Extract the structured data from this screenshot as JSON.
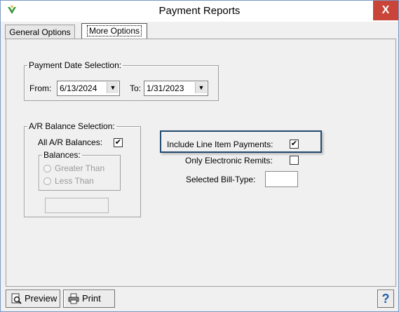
{
  "window": {
    "title": "Payment Reports",
    "close_label": "X"
  },
  "tabs": [
    {
      "label": "General Options",
      "selected": false
    },
    {
      "label": "More Options",
      "selected": true
    }
  ],
  "payment_date": {
    "legend": "Payment Date Selection:",
    "from_label": "From:",
    "from_value": "6/13/2024",
    "to_label": "To:",
    "to_value": "1/31/2023"
  },
  "ar_balance": {
    "legend": "A/R Balance Selection:",
    "all_label": "All A/R Balances:",
    "all_checked": true,
    "balances_legend": "Balances:",
    "greater_label": "Greater Than",
    "less_label": "Less Than",
    "amount_value": ""
  },
  "options": {
    "line_item_label": "Include Line Item Payments:",
    "line_item_checked": true,
    "electronic_label": "Only Electronic Remits:",
    "electronic_checked": false,
    "bill_type_label": "Selected Bill-Type:",
    "bill_type_value": ""
  },
  "buttons": {
    "preview_label": "Preview",
    "print_label": "Print",
    "help_label": "?"
  },
  "check_mark": "✔",
  "colors": {
    "close_button": "#c9453a",
    "highlight_border": "#244a70",
    "help_icon": "#1f5fa8"
  }
}
